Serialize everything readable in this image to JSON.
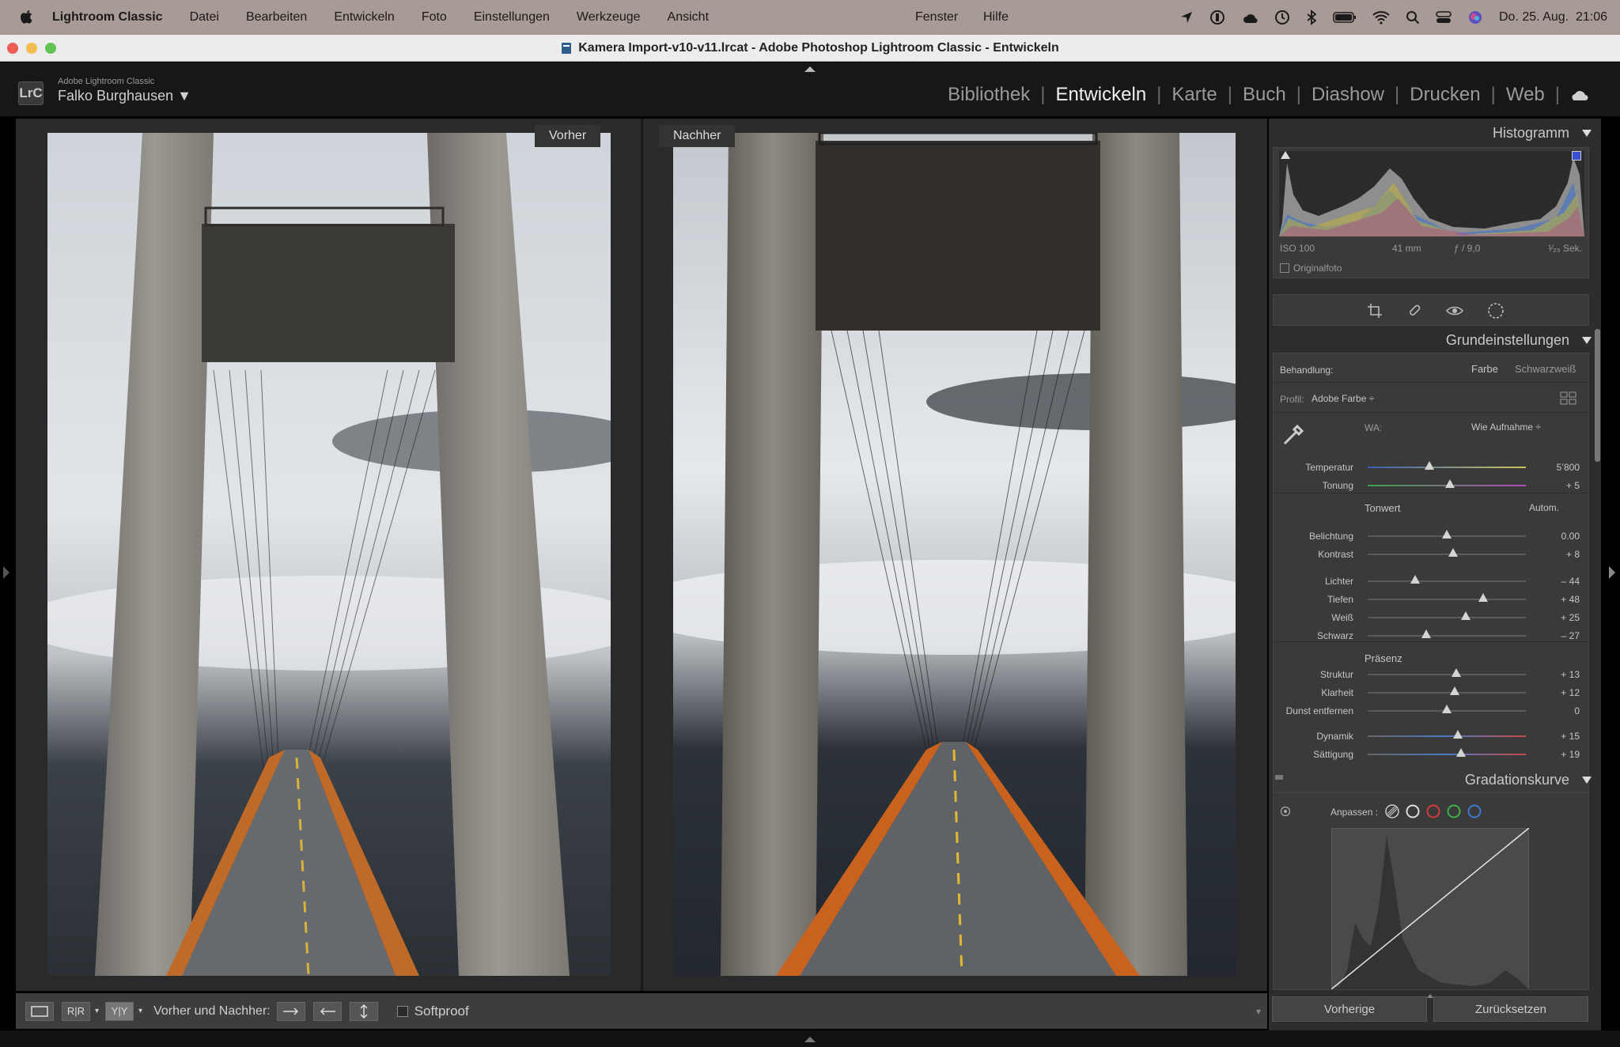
{
  "menubar": {
    "app": "Lightroom Classic",
    "items": [
      "Datei",
      "Bearbeiten",
      "Entwickeln",
      "Foto",
      "Einstellungen",
      "Werkzeuge",
      "Ansicht"
    ],
    "items_right": [
      "Fenster",
      "Hilfe"
    ],
    "clock": "Do. 25. Aug.  21:06"
  },
  "window": {
    "title": "Kamera Import-v10-v11.lrcat - Adobe Photoshop Lightroom Classic - Entwickeln"
  },
  "identity": {
    "logo": "LrC",
    "app_small": "Adobe Lightroom Classic",
    "user": "Falko Burghausen ▼"
  },
  "modules": {
    "bibliothek": "Bibliothek",
    "entwickeln": "Entwickeln",
    "karte": "Karte",
    "buch": "Buch",
    "diashow": "Diashow",
    "drucken": "Drucken",
    "web": "Web"
  },
  "view": {
    "before_label": "Vorher",
    "after_label": "Nachher"
  },
  "toolbar": {
    "ry": "R|R",
    "yy": "Y|Y",
    "before_after": "Vorher und Nachher:",
    "softproof": "Softproof"
  },
  "histogram": {
    "title": "Histogramm",
    "iso": "ISO 100",
    "focal": "41 mm",
    "aperture": "ƒ / 9,0",
    "shutter": "¹⁄₂₅ Sek.",
    "original": "Originalfoto"
  },
  "basic": {
    "title": "Grundeinstellungen",
    "treatment_label": "Behandlung:",
    "farbe": "Farbe",
    "sw": "Schwarzweiß",
    "profile_label": "Profil:",
    "profile_value": "Adobe Farbe ÷",
    "wb_label": "WA:",
    "wb_value": "Wie Aufnahme ÷",
    "tonwert": "Tonwert",
    "autom": "Autom.",
    "praesenz": "Präsenz"
  },
  "sliders": [
    {
      "label": "Temperatur",
      "value": "5’800",
      "pos": 0.39
    },
    {
      "label": "Tonung",
      "value": "+ 5",
      "pos": 0.52
    },
    {
      "label": "Belichtung",
      "value": "0.00",
      "pos": 0.5
    },
    {
      "label": "Kontrast",
      "value": "+ 8",
      "pos": 0.54
    },
    {
      "label": "Lichter",
      "value": "– 44",
      "pos": 0.3
    },
    {
      "label": "Tiefen",
      "value": "+ 48",
      "pos": 0.73
    },
    {
      "label": "Weiß",
      "value": "+ 25",
      "pos": 0.62
    },
    {
      "label": "Schwarz",
      "value": "– 27",
      "pos": 0.37
    },
    {
      "label": "Struktur",
      "value": "+ 13",
      "pos": 0.56
    },
    {
      "label": "Klarheit",
      "value": "+ 12",
      "pos": 0.55
    },
    {
      "label": "Dunst entfernen",
      "value": "0",
      "pos": 0.5
    },
    {
      "label": "Dynamik",
      "value": "+ 15",
      "pos": 0.57
    },
    {
      "label": "Sättigung",
      "value": "+ 19",
      "pos": 0.59
    }
  ],
  "curve": {
    "title": "Gradationskurve",
    "adjust_label": "Anpassen :"
  },
  "buttons": {
    "previous": "Vorherige",
    "reset": "Zurücksetzen"
  }
}
